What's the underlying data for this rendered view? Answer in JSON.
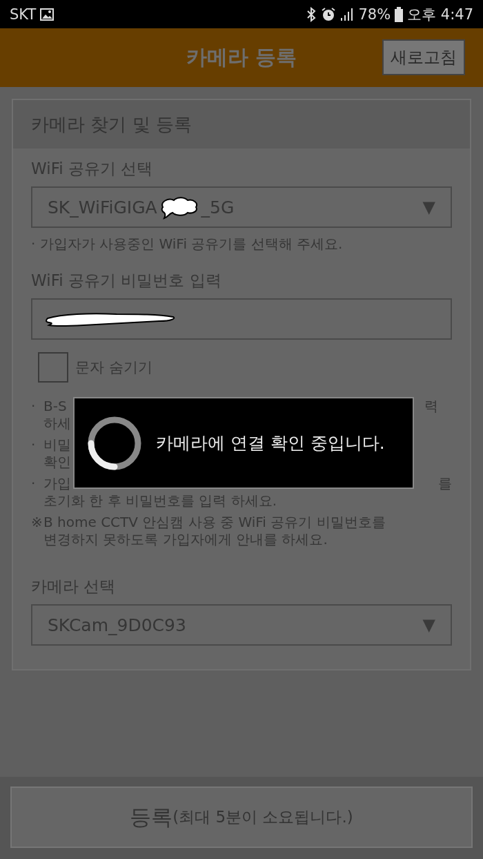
{
  "status_bar": {
    "carrier": "SKT",
    "battery": "78%",
    "time": "오후 4:47"
  },
  "header": {
    "title": "카메라 등록",
    "refresh_button": "새로고침"
  },
  "card": {
    "title": "카메라 찾기 및 등록",
    "wifi_select": {
      "label": "WiFi 공유기 선택",
      "value_start": "SK_WiFiGIGA",
      "value_end": "_5G",
      "arrow": "▼",
      "hint_mark": "·",
      "hint": "가입자가 사용중인 WiFi 공유기를 선택해 주세요."
    },
    "password": {
      "label": "WiFi 공유기 비밀번호 입력"
    },
    "hide_chars": {
      "label": "문자 숨기기",
      "checked": false
    },
    "notes": [
      {
        "mark": "·",
        "lines": [
          {
            "left": "B-S",
            "right": "력"
          },
          {
            "left": "하세"
          }
        ]
      },
      {
        "mark": "·",
        "lines": [
          {
            "left": "비밀"
          },
          {
            "left": "확인"
          }
        ]
      },
      {
        "mark": "·",
        "lines": [
          {
            "left": "가입",
            "right": "를"
          },
          {
            "left": "초기화 한 후 비밀번호를 입력 하세요."
          }
        ]
      },
      {
        "mark": "※",
        "lines": [
          {
            "left": "B home CCTV 안심캠 사용 중 WiFi 공유기 비밀번호를"
          },
          {
            "left": "변경하지 못하도록 가입자에게 안내를 하세요."
          }
        ]
      }
    ],
    "camera_select": {
      "label": "카메라 선택",
      "value": "SKCam_9D0C93",
      "arrow": "▼"
    }
  },
  "register_button": {
    "label": "등록",
    "note": "(최대 5분이 소요됩니다.)"
  },
  "dialog": {
    "message": "카메라에 연결 확인 중입니다."
  }
}
